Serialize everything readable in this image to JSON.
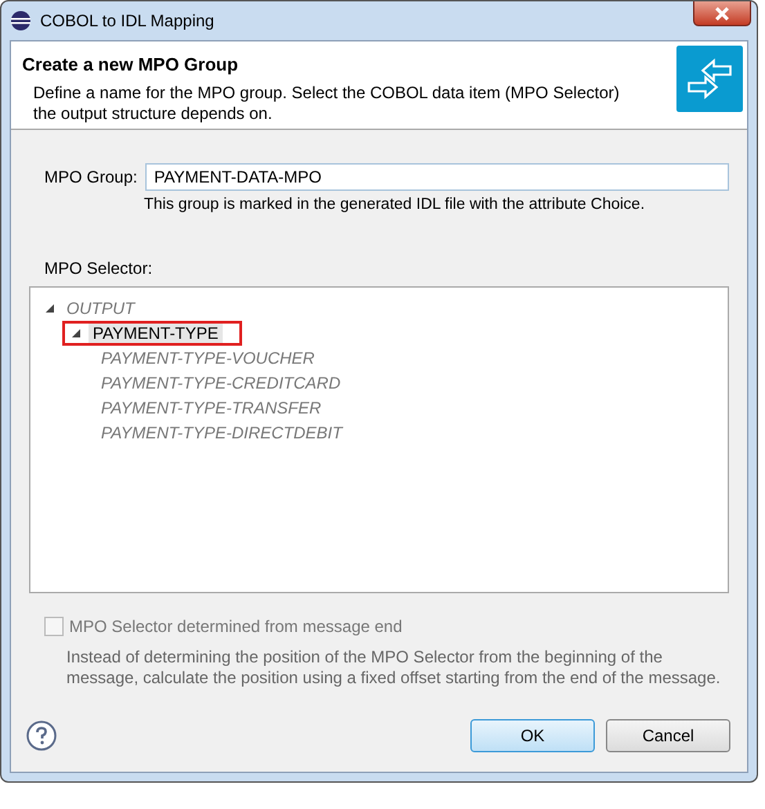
{
  "window": {
    "title": "COBOL to IDL Mapping"
  },
  "header": {
    "title": "Create a new MPO Group",
    "description": "Define a name for the MPO group. Select the COBOL data item (MPO Selector) the output structure depends on."
  },
  "mpo_group": {
    "label": "MPO Group:",
    "value": "PAYMENT-DATA-MPO",
    "hint": "This group is marked in the generated IDL file with the attribute Choice."
  },
  "mpo_selector": {
    "label": "MPO Selector:",
    "tree": [
      {
        "label": "OUTPUT",
        "enabled": false,
        "selected": false,
        "highlighted": false,
        "expanded": true,
        "children": [
          {
            "label": "PAYMENT-TYPE",
            "enabled": true,
            "selected": true,
            "highlighted": true,
            "expanded": true,
            "children": [
              {
                "label": "PAYMENT-TYPE-VOUCHER",
                "enabled": false,
                "selected": false,
                "highlighted": false
              },
              {
                "label": "PAYMENT-TYPE-CREDITCARD",
                "enabled": false,
                "selected": false,
                "highlighted": false
              },
              {
                "label": "PAYMENT-TYPE-TRANSFER",
                "enabled": false,
                "selected": false,
                "highlighted": false
              },
              {
                "label": "PAYMENT-TYPE-DIRECTDEBIT",
                "enabled": false,
                "selected": false,
                "highlighted": false
              }
            ]
          }
        ]
      }
    ]
  },
  "message_end": {
    "label": "MPO Selector determined from message end",
    "checked": false,
    "disabled": true,
    "description": "Instead of determining the position of the MPO Selector from the beginning of the message, calculate the position using a fixed offset starting from the end of the message."
  },
  "buttons": [
    {
      "label": "OK",
      "default": true
    },
    {
      "label": "Cancel",
      "default": false
    }
  ]
}
